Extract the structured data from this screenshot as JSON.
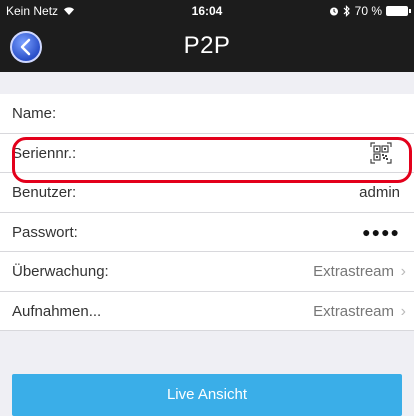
{
  "status": {
    "carrier": "Kein Netz",
    "time": "16:04",
    "battery_text": "70 %"
  },
  "nav": {
    "title": "P2P"
  },
  "fields": {
    "name_label": "Name:",
    "name_value": "",
    "serial_label": "Seriennr.:",
    "user_label": "Benutzer:",
    "user_value": "admin",
    "password_label": "Passwort:",
    "password_value": "●●●●",
    "monitor_label": "Überwachung:",
    "monitor_value": "Extrastream",
    "record_label": "Aufnahmen...",
    "record_value": "Extrastream"
  },
  "actions": {
    "live_label": "Live Ansicht"
  },
  "colors": {
    "accent": "#3aaee8",
    "highlight": "#e3001b"
  }
}
